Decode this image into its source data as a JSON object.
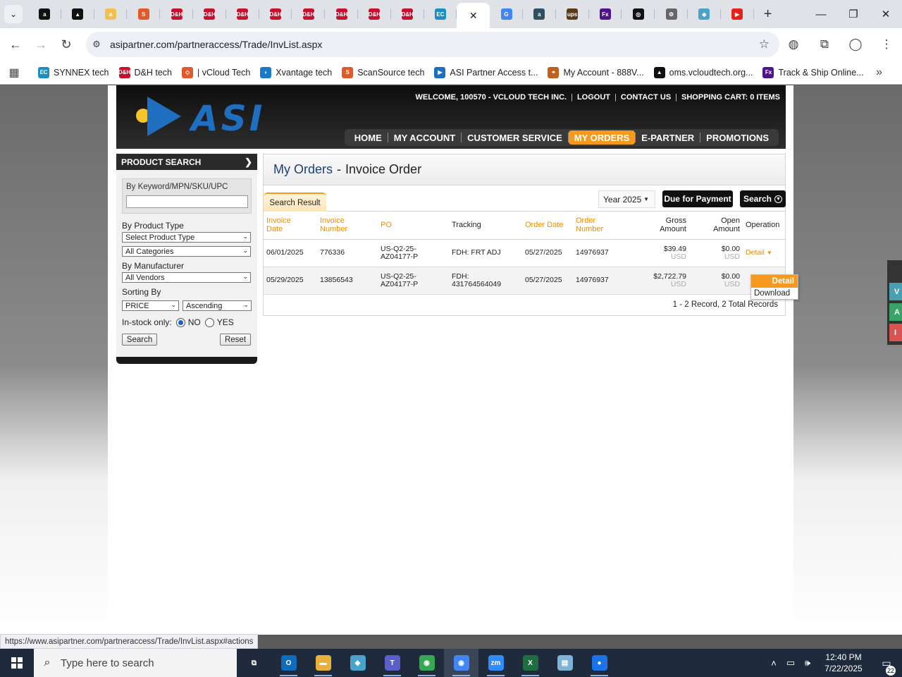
{
  "browser": {
    "tabs": [
      {
        "icon": "amazon-icon",
        "glyph": "a",
        "color": "#111111"
      },
      {
        "icon": "avalara-icon",
        "glyph": "▲",
        "color": "#111111"
      },
      {
        "icon": "amazon-icon",
        "glyph": "a",
        "color": "#f0c050"
      },
      {
        "icon": "scansource-icon",
        "glyph": "S",
        "color": "#e05a2a"
      },
      {
        "icon": "dh-icon",
        "glyph": "D&H",
        "color": "#c8102e"
      },
      {
        "icon": "dh-icon",
        "glyph": "D&H",
        "color": "#c8102e"
      },
      {
        "icon": "dh-icon",
        "glyph": "D&H",
        "color": "#c8102e"
      },
      {
        "icon": "dh-icon",
        "glyph": "D&H",
        "color": "#c8102e"
      },
      {
        "icon": "dh-icon",
        "glyph": "D&H",
        "color": "#c8102e"
      },
      {
        "icon": "dh-icon",
        "glyph": "D&H",
        "color": "#c8102e"
      },
      {
        "icon": "dh-icon",
        "glyph": "D&H",
        "color": "#c8102e"
      },
      {
        "icon": "dh-icon",
        "glyph": "D&H",
        "color": "#c8102e"
      },
      {
        "icon": "ec-icon",
        "glyph": "EC",
        "color": "#1a8fc2"
      },
      {
        "icon": "close-icon",
        "glyph": "✕",
        "color": "#ffffff",
        "active": true
      },
      {
        "icon": "google-icon",
        "glyph": "G",
        "color": "#4285f4"
      },
      {
        "icon": "amazon-icon",
        "glyph": "a",
        "color": "#2f4f5f"
      },
      {
        "icon": "ups-icon",
        "glyph": "ups",
        "color": "#5a3a1a"
      },
      {
        "icon": "fedex-icon",
        "glyph": "Fx",
        "color": "#4d148c"
      },
      {
        "icon": "openai-icon",
        "glyph": "◎",
        "color": "#111111"
      },
      {
        "icon": "extension-icon",
        "glyph": "⚙",
        "color": "#666666"
      },
      {
        "icon": "gem-icon",
        "glyph": "◆",
        "color": "#4aa3c8"
      },
      {
        "icon": "youtube-icon",
        "glyph": "▶",
        "color": "#e62117"
      }
    ],
    "new_tab": "+",
    "address": "asipartner.com/partneraccess/Trade/InvList.aspx",
    "bookmarks": [
      {
        "icon": "synnex-icon",
        "glyph": "EC",
        "color": "#1a8fc2",
        "label": "SYNNEX tech"
      },
      {
        "icon": "dh-icon",
        "glyph": "D&H",
        "color": "#c8102e",
        "label": "D&H tech"
      },
      {
        "icon": "vcloud-icon",
        "glyph": "◇",
        "color": "#e0592a",
        "label": "| vCloud Tech"
      },
      {
        "icon": "xvantage-icon",
        "glyph": "◗",
        "color": "#1a7ac8",
        "label": "Xvantage tech"
      },
      {
        "icon": "scansource-icon",
        "glyph": "S",
        "color": "#e05a2a",
        "label": "ScanSource tech"
      },
      {
        "icon": "asi-icon",
        "glyph": "▶",
        "color": "#1e6fc0",
        "label": "ASI Partner Access t..."
      },
      {
        "icon": "account-icon",
        "glyph": "⚭",
        "color": "#c06020",
        "label": "My Account - 888V..."
      },
      {
        "icon": "avalara-icon",
        "glyph": "▲",
        "color": "#111111",
        "label": "oms.vcloudtech.org..."
      },
      {
        "icon": "fedex-icon",
        "glyph": "Fx",
        "color": "#4d148c",
        "label": "Track & Ship Online..."
      }
    ]
  },
  "site": {
    "welcome": "WELCOME, 100570 - VCLOUD TECH INC.",
    "logout": "LOGOUT",
    "contact": "CONTACT US",
    "cart": "SHOPPING CART: 0 ITEMS",
    "logo_text": "ASI",
    "nav": [
      "HOME",
      "MY ACCOUNT",
      "CUSTOMER SERVICE",
      "MY ORDERS",
      "E-PARTNER",
      "PROMOTIONS"
    ],
    "nav_active": "MY ORDERS"
  },
  "sidebar": {
    "title": "PRODUCT SEARCH",
    "keyword_label": "By Keyword/MPN/SKU/UPC",
    "keyword_value": "",
    "product_type_label": "By Product Type",
    "product_type_value": "Select Product Type",
    "category_value": "All Categories",
    "manufacturer_label": "By Manufacturer",
    "manufacturer_value": "All Vendors",
    "sorting_label": "Sorting By",
    "sort_field": "PRICE",
    "sort_order": "Ascending",
    "instock_label": "In-stock only:",
    "instock_no": "NO",
    "instock_yes": "YES",
    "instock_selected": "NO",
    "search_btn": "Search",
    "reset_btn": "Reset"
  },
  "main": {
    "title_part1": "My Orders",
    "title_sep": "-",
    "title_part2": "Invoice Order",
    "tab_label": "Search Result",
    "year_value": "Year 2025",
    "due_btn": "Due for Payment",
    "search_btn": "Search",
    "columns": [
      {
        "line1": "Invoice",
        "line2": "Date",
        "orange": true
      },
      {
        "line1": "Invoice",
        "line2": "Number",
        "orange": true
      },
      {
        "line1": "PO",
        "line2": "",
        "orange": true
      },
      {
        "line1": "Tracking",
        "line2": "",
        "orange": false
      },
      {
        "line1": "Order Date",
        "line2": "",
        "orange": true
      },
      {
        "line1": "Order",
        "line2": "Number",
        "orange": true
      },
      {
        "line1": "Gross",
        "line2": "Amount",
        "orange": false
      },
      {
        "line1": "Open",
        "line2": "Amount",
        "orange": false
      },
      {
        "line1": "Operation",
        "line2": "",
        "orange": false
      }
    ],
    "rows": [
      {
        "invoice_date": "06/01/2025",
        "invoice_number": "776336",
        "po1": "US-Q2-25-",
        "po2": "AZ04177-P",
        "tracking1": "FDH: FRT ADJ",
        "tracking2": "",
        "order_date": "05/27/2025",
        "order_number": "14976937",
        "gross": "$39.49",
        "open": "$0.00",
        "currency": "USD",
        "operation": "Detail"
      },
      {
        "invoice_date": "05/29/2025",
        "invoice_number": "13856543",
        "po1": "US-Q2-25-",
        "po2": "AZ04177-P",
        "tracking1": "FDH:",
        "tracking2": "431764564049",
        "order_date": "05/27/2025",
        "order_number": "14976937",
        "gross": "$2,722.79",
        "open": "$0.00",
        "currency": "USD",
        "operation": ""
      }
    ],
    "records": "1 - 2 Record,  2 Total Records",
    "dropdown": {
      "detail": "Detail",
      "download": "Download"
    }
  },
  "side_tabs": [
    {
      "letter": "V",
      "color": "#4a9fb0"
    },
    {
      "letter": "A",
      "color": "#3aa36a"
    },
    {
      "letter": "I",
      "color": "#d9534f"
    }
  ],
  "status_url": "https://www.asipartner.com/partneraccess/Trade/InvList.aspx#actions",
  "taskbar": {
    "search_placeholder": "Type here to search",
    "apps": [
      {
        "name": "task-view-icon",
        "glyph": "⧉",
        "color": "#1f2b3c"
      },
      {
        "name": "outlook-icon",
        "glyph": "O",
        "color": "#0f6cbd"
      },
      {
        "name": "file-explorer-icon",
        "glyph": "▬",
        "color": "#e8b23a"
      },
      {
        "name": "app-gem-icon",
        "glyph": "◆",
        "color": "#4aa3c8"
      },
      {
        "name": "teams-icon",
        "glyph": "T",
        "color": "#5b5fc7"
      },
      {
        "name": "chrome-icon",
        "glyph": "◉",
        "color": "#34a853"
      },
      {
        "name": "chrome-profile-icon",
        "glyph": "◉",
        "color": "#4285f4"
      },
      {
        "name": "zoom-icon",
        "glyph": "zm",
        "color": "#2d8cff"
      },
      {
        "name": "excel-icon",
        "glyph": "X",
        "color": "#1d6f42"
      },
      {
        "name": "notepad-icon",
        "glyph": "▤",
        "color": "#7fb3d5"
      },
      {
        "name": "app-blue-icon",
        "glyph": "●",
        "color": "#1a73e8"
      }
    ],
    "time": "12:40 PM",
    "date": "7/22/2025",
    "notifications": "22"
  }
}
